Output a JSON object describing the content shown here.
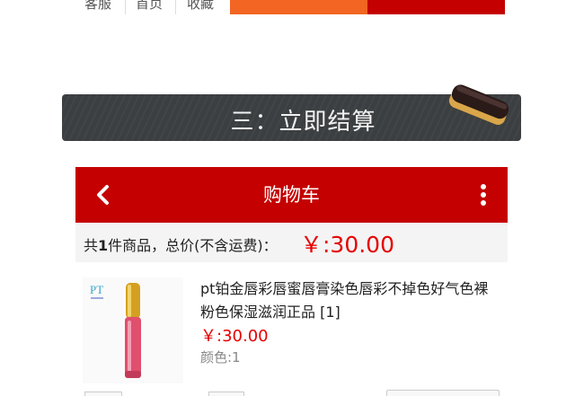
{
  "topbar": {
    "links": [
      "客服",
      "首页",
      "收藏"
    ]
  },
  "banner": {
    "title": "三：立即结算"
  },
  "cart_header": {
    "title": "购物车"
  },
  "summary": {
    "prefix": "共",
    "count": "1",
    "suffix": "件商品，总价(不含运费)：",
    "total": "￥:30.00"
  },
  "product": {
    "name": "pt铂金唇彩唇蜜唇膏染色唇彩不掉色好气色裸粉色保湿滋润正品 [1]",
    "price": "￥:30.00",
    "attr": "颜色:1",
    "brand_mark": "PT"
  },
  "colors": {
    "brand_red": "#c40000",
    "accent_orange": "#f26522",
    "price_red": "#e60000"
  }
}
